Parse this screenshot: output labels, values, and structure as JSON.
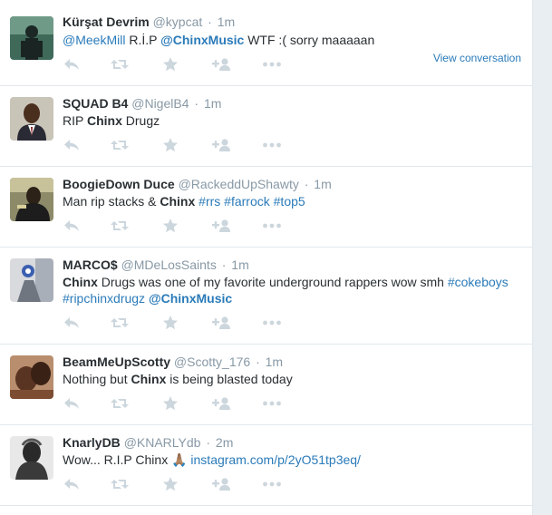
{
  "colors": {
    "link": "#2b7bb9",
    "muted": "#8899a6",
    "text": "#292f33",
    "icon": "#ccd6dd"
  },
  "tweets": [
    {
      "fullname": "Kürşat Devrim",
      "username": "@kypcat",
      "time": "1m",
      "text": {
        "mention1": "@MeekMill",
        "t1": " R.İ.P ",
        "mention2": "@ChinxMusic",
        "t2": "  WTF :( sorry maaaaan"
      },
      "view_conversation": "View conversation"
    },
    {
      "fullname": "SQUAD B4",
      "username": "@NigelB4",
      "time": "1m",
      "text": {
        "t1": "RIP ",
        "bold1": "Chinx",
        "t2": " Drugz"
      }
    },
    {
      "fullname": "BoogieDown Duce",
      "username": "@RackeddUpShawty",
      "time": "1m",
      "text": {
        "t1": "Man rip stacks & ",
        "bold1": "Chinx",
        "t2": " ",
        "hashtag1": "#rrs",
        "t3": " ",
        "hashtag2": "#farrock",
        "t4": " ",
        "hashtag3": "#top5"
      }
    },
    {
      "fullname": "MARCO$",
      "username": "@MDeLosSaints",
      "time": "1m",
      "text": {
        "bold1": "Chinx",
        "t1": " Drugs was one of my favorite underground rappers wow smh ",
        "hashtag1": "#cokeboys",
        "hashtag2": "#ripchinxdrugz",
        "t2": " ",
        "mention1": "@ChinxMusic"
      }
    },
    {
      "fullname": "BeamMeUpScotty",
      "username": "@Scotty_176",
      "time": "1m",
      "text": {
        "t1": "Nothing but ",
        "bold1": "Chinx",
        "t2": " is being blasted today"
      }
    },
    {
      "fullname": "KnarlyDB",
      "username": "@KNARLYdb",
      "time": "2m",
      "text": {
        "t1": "Wow... R.I.P Chinx 🙏🏽 ",
        "link1": "instagram.com/p/2yO51tp3eq/"
      }
    }
  ],
  "separator": "·",
  "icons": [
    "reply-icon",
    "retweet-icon",
    "favorite-icon",
    "follow-icon",
    "more-icon"
  ]
}
